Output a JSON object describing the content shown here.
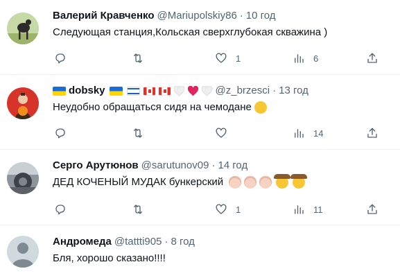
{
  "tweets": [
    {
      "name": "Валерий Кравченко",
      "handle": "@Mariupolskiy86",
      "sep": "·",
      "time": "10 год",
      "text": "Следующая станция,Кольская сверхглубокая скважина )",
      "likes": "1",
      "views": "6"
    },
    {
      "name": "dobsky",
      "handle": "@z_brzesci",
      "sep": "·",
      "time": "13 год",
      "text": "Неудобно обращаться сидя на чемодане",
      "views": "14"
    },
    {
      "name": "Серго Арутюнов",
      "handle": "@sarutunov09",
      "sep": "·",
      "time": "14 год",
      "text": "ДЕД КОЧЕНЫЙ МУДАК бункерский",
      "likes": "1",
      "views": "11"
    },
    {
      "name": "Андромеда",
      "handle": "@tattti905",
      "sep": "·",
      "time": "8 год",
      "text": "Бля, хорошо сказано!!!!"
    }
  ],
  "icons": {
    "reply": "reply-icon",
    "retweet": "retweet-icon",
    "like": "like-icon",
    "views": "views-icon",
    "share": "share-icon"
  },
  "colors": {
    "text": "#0f1419",
    "secondary": "#536471",
    "divider": "#eff3f4",
    "heart_red": "#e0245e"
  }
}
